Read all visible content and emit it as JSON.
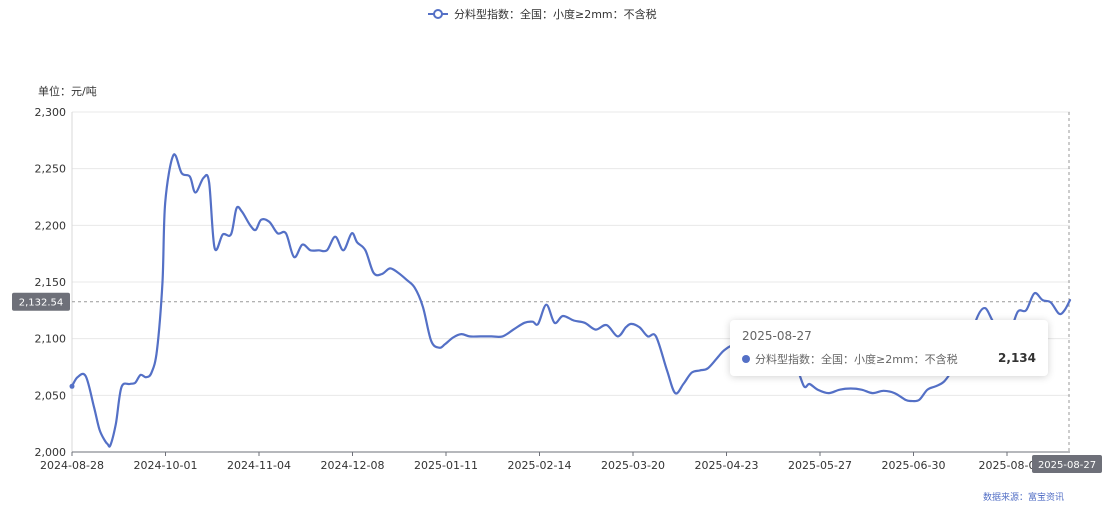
{
  "chart_data": {
    "type": "line",
    "legend": {
      "entries": [
        "分料型指数：全国：小度≥2mm：不含税"
      ],
      "placement": "top-center"
    },
    "unit_label": "单位：元/吨",
    "source": "数据来源：富宝资讯",
    "ylim": [
      2000,
      2300
    ],
    "y_ticks": [
      "2,000",
      "2,050",
      "2,100",
      "2,150",
      "2,200",
      "2,250",
      "2,300"
    ],
    "x_ticks": [
      "2024-08-28",
      "2024-10-01",
      "2024-11-04",
      "2024-12-08",
      "2025-01-11",
      "2025-02-14",
      "2025-03-20",
      "2025-04-23",
      "2025-05-27",
      "2025-06-30",
      "2025-08-0"
    ],
    "x_range": [
      "2024-08-28",
      "2025-08-27"
    ],
    "grid": "horizontal",
    "color": "#5470c6",
    "series": [
      {
        "name": "分料型指数：全国：小度≥2mm：不含税",
        "x": [
          "2024-08-28",
          "2024-08-30",
          "2024-09-02",
          "2024-09-05",
          "2024-09-07",
          "2024-09-09",
          "2024-09-10",
          "2024-09-11",
          "2024-09-13",
          "2024-09-15",
          "2024-09-18",
          "2024-09-20",
          "2024-09-22",
          "2024-09-24",
          "2024-09-26",
          "2024-09-28",
          "2024-09-30",
          "2024-10-01",
          "2024-10-04",
          "2024-10-07",
          "2024-10-10",
          "2024-10-12",
          "2024-10-15",
          "2024-10-17",
          "2024-10-19",
          "2024-10-22",
          "2024-10-25",
          "2024-10-27",
          "2024-10-29",
          "2024-11-01",
          "2024-11-03",
          "2024-11-05",
          "2024-11-08",
          "2024-11-11",
          "2024-11-14",
          "2024-11-17",
          "2024-11-20",
          "2024-11-23",
          "2024-11-26",
          "2024-11-29",
          "2024-12-02",
          "2024-12-05",
          "2024-12-08",
          "2024-12-10",
          "2024-12-13",
          "2024-12-16",
          "2024-12-19",
          "2024-12-22",
          "2024-12-25",
          "2024-12-28",
          "2024-12-31",
          "2025-01-03",
          "2025-01-06",
          "2025-01-09",
          "2025-01-11",
          "2025-01-14",
          "2025-01-17",
          "2025-01-20",
          "2025-01-24",
          "2025-01-28",
          "2025-02-01",
          "2025-02-05",
          "2025-02-09",
          "2025-02-12",
          "2025-02-14",
          "2025-02-17",
          "2025-02-20",
          "2025-02-23",
          "2025-02-27",
          "2025-03-03",
          "2025-03-07",
          "2025-03-11",
          "2025-03-15",
          "2025-03-18",
          "2025-03-20",
          "2025-03-23",
          "2025-03-26",
          "2025-03-29",
          "2025-04-02",
          "2025-04-05",
          "2025-04-08",
          "2025-04-11",
          "2025-04-14",
          "2025-04-17",
          "2025-04-21",
          "2025-04-23",
          "2025-04-26",
          "2025-04-29",
          "2025-05-02",
          "2025-05-06",
          "2025-05-10",
          "2025-05-13",
          "2025-05-16",
          "2025-05-19",
          "2025-05-22",
          "2025-05-24",
          "2025-05-27",
          "2025-05-31",
          "2025-06-04",
          "2025-06-08",
          "2025-06-12",
          "2025-06-16",
          "2025-06-20",
          "2025-06-24",
          "2025-06-28",
          "2025-06-30",
          "2025-07-03",
          "2025-07-06",
          "2025-07-09",
          "2025-07-12",
          "2025-07-15",
          "2025-07-18",
          "2025-07-21",
          "2025-07-24",
          "2025-07-27",
          "2025-07-30",
          "2025-08-02",
          "2025-08-05",
          "2025-08-08",
          "2025-08-11",
          "2025-08-14",
          "2025-08-17",
          "2025-08-20",
          "2025-08-23",
          "2025-08-25",
          "2025-08-27"
        ],
        "values": [
          2058,
          2066,
          2067,
          2040,
          2020,
          2010,
          2007,
          2006,
          2025,
          2057,
          2060,
          2061,
          2068,
          2066,
          2070,
          2090,
          2150,
          2220,
          2262,
          2246,
          2243,
          2229,
          2242,
          2238,
          2180,
          2192,
          2192,
          2215,
          2212,
          2200,
          2196,
          2205,
          2203,
          2193,
          2193,
          2172,
          2183,
          2178,
          2178,
          2178,
          2190,
          2178,
          2193,
          2185,
          2178,
          2158,
          2157,
          2162,
          2158,
          2152,
          2145,
          2128,
          2098,
          2092,
          2095,
          2101,
          2104,
          2102,
          2102,
          2102,
          2102,
          2108,
          2114,
          2115,
          2113,
          2130,
          2114,
          2120,
          2116,
          2114,
          2108,
          2112,
          2102,
          2110,
          2113,
          2110,
          2102,
          2102,
          2072,
          2052,
          2060,
          2070,
          2072,
          2074,
          2085,
          2090,
          2094,
          2090,
          2088,
          2082,
          2078,
          2074,
          2080,
          2076,
          2058,
          2060,
          2055,
          2052,
          2055,
          2056,
          2055,
          2052,
          2054,
          2052,
          2046,
          2045,
          2046,
          2055,
          2058,
          2062,
          2072,
          2085,
          2092,
          2118,
          2127,
          2115,
          2108,
          2106,
          2124,
          2125,
          2140,
          2134,
          2132,
          2122,
          2125,
          2134
        ]
      }
    ],
    "crosshair": {
      "y_label": "2,132.54",
      "x_label": "2025-08-27"
    },
    "tooltip": {
      "date": "2025-08-27",
      "series_name": "分料型指数：全国：小度≥2mm：不含税",
      "value": "2,134"
    }
  }
}
